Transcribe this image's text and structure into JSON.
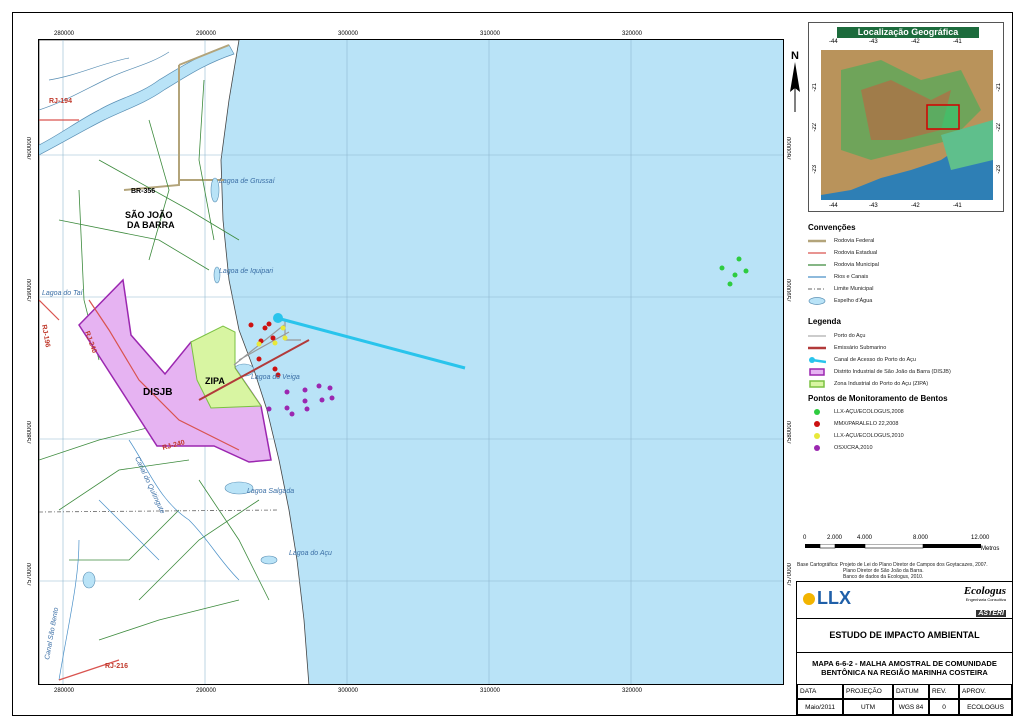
{
  "map": {
    "x_ticks": [
      "280000",
      "290000",
      "300000",
      "310000",
      "320000"
    ],
    "y_ticks": [
      "7600000",
      "7590000",
      "7580000",
      "7570000"
    ],
    "places": {
      "sao_joao_l1": "SÃO JOÃO",
      "sao_joao_l2": "DA BARRA",
      "disjb": "DISJB",
      "zipa": "ZIPA"
    },
    "roads": {
      "rj194": "RJ-194",
      "br356": "BR-356",
      "rj196": "RJ-196",
      "rj240a": "RJ-240",
      "rj240b": "RJ-240",
      "rj216": "RJ-216"
    },
    "water": {
      "grussai": "Lagoa de Grussaí",
      "iquipari": "Lagoa de Iquipari",
      "tai": "Lagoa do Taí",
      "veiga": "Lagoa do Veiga",
      "salgada": "Lagoa Salgada",
      "acu": "Lagoa do Açu",
      "quitingute": "Canal do Quitingute",
      "sao_bento": "Canal São Bento"
    }
  },
  "inset": {
    "title": "Localização Geográfica",
    "lon_ticks": [
      "-44",
      "-43",
      "-42",
      "-41"
    ],
    "lat_ticks": [
      "-21",
      "-22",
      "-23"
    ]
  },
  "north": "N",
  "conventions": {
    "title": "Convenções",
    "items": [
      "Rodovia Federal",
      "Rodovia Estadual",
      "Rodovia Municipal",
      "Rios e Canais",
      "Limite Municipal",
      "Espelho d'Água"
    ]
  },
  "legend": {
    "title": "Legenda",
    "items": [
      "Porto do Açu",
      "Emissário Submarino",
      "Canal de Acesso do Porto do Açu",
      "Distrito Industrial de São João da Barra (DISJB)",
      "Zona Industrial do Porto do Açu (ZIPA)"
    ]
  },
  "monitoring": {
    "title": "Pontos de Monitoramento de Bentos",
    "items": [
      {
        "label": "LLX-AÇU/ECOLOGUS,2008",
        "color": "#2ecc40"
      },
      {
        "label": "MMX/PARALELO 22,2008",
        "color": "#cc1111"
      },
      {
        "label": "LLX-AÇU/ECOLOGUS,2010",
        "color": "#e8e83a"
      },
      {
        "label": "OSX/CRA,2010",
        "color": "#9b27b0"
      }
    ]
  },
  "scale": {
    "labels": [
      "0",
      "2.000",
      "4.000",
      "8.000",
      "12.000"
    ],
    "unit": "Metros"
  },
  "source": {
    "line1": "Base Cartográfica: Projeto de Lei do Plano Diretor de Campos dos Goytacazes, 2007.",
    "line2": "Plano Diretor de São João da Barra.",
    "line3": "Banco de dados da Ecologus, 2010."
  },
  "logos": {
    "llx": "LLX",
    "ecologus": "Ecologus",
    "ecologus_sub": "Engenharia Consultiva",
    "asteri": "ASTERI"
  },
  "titleblock": {
    "study": "ESTUDO DE IMPACTO AMBIENTAL",
    "map_title_1": "MAPA 6-6-2 - MALHA AMOSTRAL DE COMUNIDADE",
    "map_title_2": "BENTÔNICA NA REGIÃO MARINHA COSTEIRA",
    "headers": [
      "DATA",
      "PROJEÇÃO",
      "DATUM",
      "REV.",
      "APROV."
    ],
    "values": [
      "Maio/2011",
      "UTM",
      "WGS 84",
      "0",
      "ECOLOGUS"
    ]
  }
}
